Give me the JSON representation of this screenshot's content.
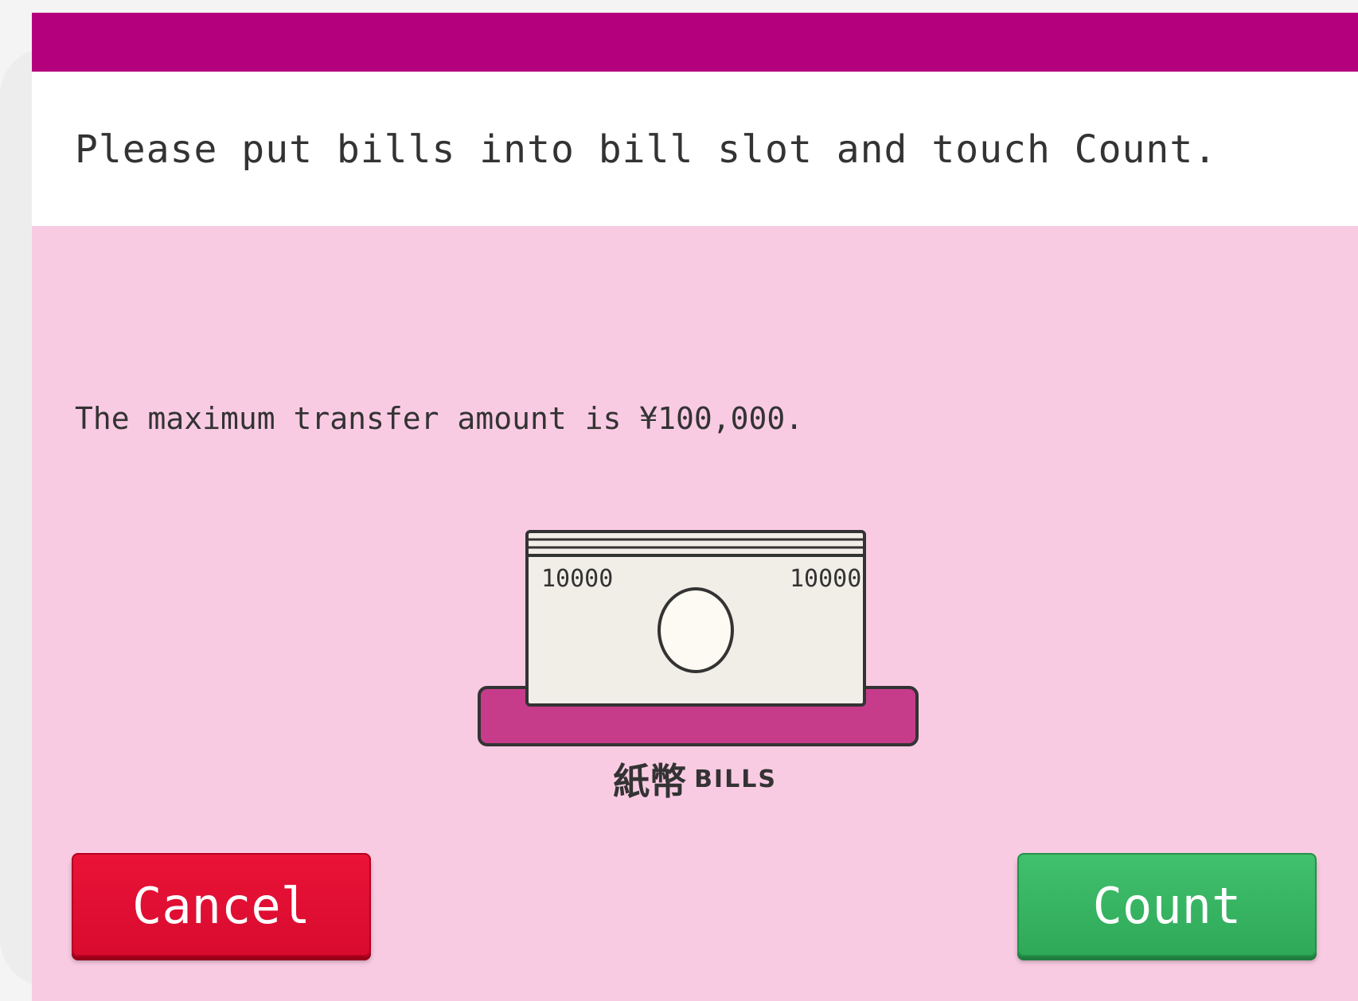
{
  "header": {
    "instruction": "Please put bills into bill slot and touch Count.",
    "bar_color": "#b5007d"
  },
  "main": {
    "limit_notice": "The maximum transfer amount is ¥100,000.",
    "background_color": "#f9cbe3",
    "bill": {
      "denomination_left": "10000",
      "denomination_right": "10000",
      "tray_color": "#c73c8a"
    },
    "bills_label_ja": "紙幣",
    "bills_label_en": "BILLS"
  },
  "buttons": {
    "cancel_label": "Cancel",
    "count_label": "Count",
    "cancel_color": "#e21034",
    "count_color": "#36b463"
  }
}
